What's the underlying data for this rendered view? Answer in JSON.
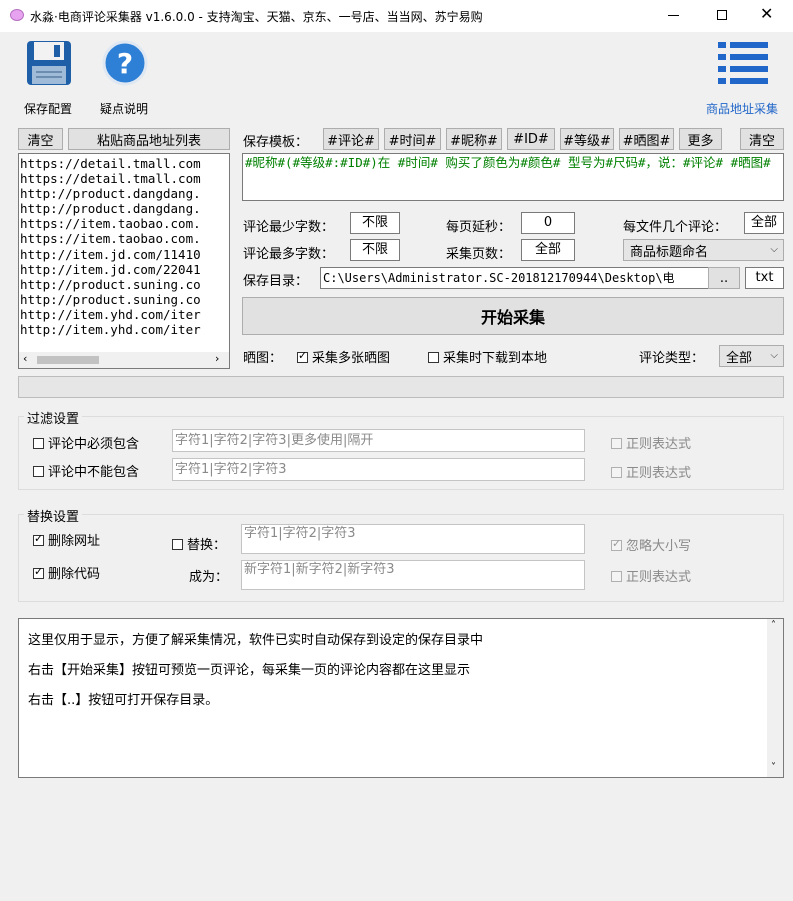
{
  "window": {
    "title": "水淼·电商评论采集器 v1.6.0.0 - 支持淘宝、天猫、京东、一号店、当当网、苏宁易购",
    "icons": [
      "minimize-icon",
      "maximize-icon",
      "close-icon"
    ]
  },
  "toolbar": {
    "save_config": "保存配置",
    "help": "疑点说明",
    "url_collect": "商品地址采集"
  },
  "url_panel": {
    "clear": "清空",
    "paste": "粘贴商品地址列表",
    "urls": [
      "https://detail.tmall.com",
      "https://detail.tmall.com",
      "http://product.dangdang.",
      "http://product.dangdang.",
      "https://item.taobao.com.",
      "https://item.taobao.com.",
      "http://item.jd.com/11410",
      "http://item.jd.com/22041",
      "http://product.suning.co",
      "http://product.suning.co",
      "http://item.yhd.com/iter",
      "http://item.yhd.com/iter"
    ]
  },
  "template": {
    "label": "保存模板：",
    "tags": [
      "#评论#",
      "#时间#",
      "#昵称#",
      "#ID#",
      "#等级#",
      "#晒图#"
    ],
    "more": "更多",
    "clear": "清空",
    "value": "#昵称#(#等级#:#ID#)在 #时间# 购买了颜色为#颜色# 型号为#尺码#，说：#评论# #晒图#"
  },
  "options": {
    "min_chars_label": "评论最少字数：",
    "min_chars": "不限",
    "delay_label": "每页延秒：",
    "delay": "0",
    "per_file_label": "每文件几个评论：",
    "per_file": "全部",
    "max_chars_label": "评论最多字数：",
    "max_chars": "不限",
    "pages_label": "采集页数：",
    "pages": "全部",
    "naming": "商品标题命名"
  },
  "save_dir": {
    "label": "保存目录：",
    "path": "C:\\Users\\Administrator.SC-201812170944\\Desktop\\电",
    "browse": "..",
    "ext": "txt"
  },
  "start_button": "开始采集",
  "images": {
    "label": "晒图：",
    "multi": "采集多张晒图",
    "download": "采集时下载到本地",
    "type_label": "评论类型：",
    "type": "全部"
  },
  "filter": {
    "title": "过滤设置",
    "must_contain": "评论中必须包含",
    "must_contain_ph": "字符1|字符2|字符3|更多使用|隔开",
    "not_contain": "评论中不能包含",
    "not_contain_ph": "字符1|字符2|字符3",
    "regex1": "正则表达式",
    "regex2": "正则表达式"
  },
  "replace": {
    "title": "替换设置",
    "delete_url": "删除网址",
    "delete_code": "删除代码",
    "replace": "替换：",
    "replace_ph": "字符1|字符2|字符3",
    "to": "成为：",
    "to_ph": "新字符1|新字符2|新字符3",
    "ignore_case": "忽略大小写",
    "regex": "正则表达式"
  },
  "log": {
    "lines": [
      "这里仅用于显示，方便了解采集情况，软件已实时自动保存到设定的保存目录中",
      "右击【开始采集】按钮可预览一页评论，每采集一页的评论内容都在这里显示",
      "右击【..】按钮可打开保存目录。"
    ]
  },
  "colors": {
    "accent": "#2166c9",
    "template_text": "#008000",
    "title_bar": "#ffffff"
  }
}
